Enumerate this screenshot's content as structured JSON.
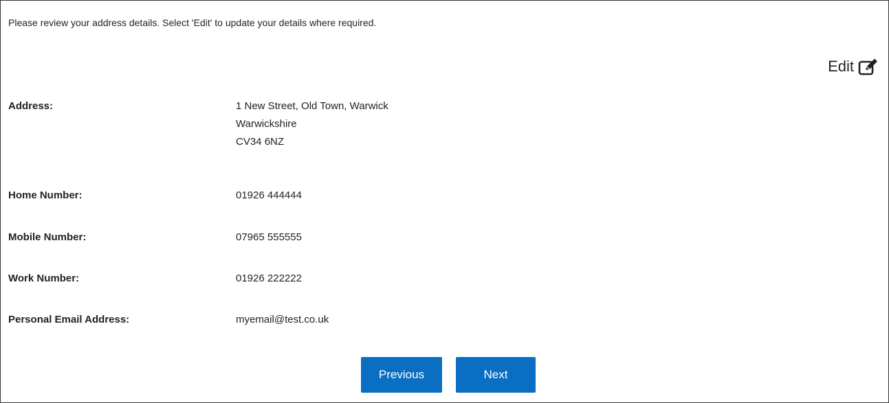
{
  "intro": "Please review your address details. Select 'Edit' to update your details where required.",
  "edit": {
    "label": "Edit",
    "icon": "edit-icon"
  },
  "fields": {
    "address": {
      "label": "Address:",
      "lines": [
        "1 New Street, Old Town, Warwick",
        "Warwickshire",
        "CV34 6NZ"
      ]
    },
    "home": {
      "label": "Home Number:",
      "value": "01926 444444"
    },
    "mobile": {
      "label": "Mobile Number:",
      "value": "07965 555555"
    },
    "work": {
      "label": "Work Number:",
      "value": "01926 222222"
    },
    "email": {
      "label": "Personal Email Address:",
      "value": "myemail@test.co.uk"
    }
  },
  "buttons": {
    "previous": "Previous",
    "next": "Next"
  },
  "colors": {
    "button_bg": "#0a6fc2",
    "button_text": "#ffffff",
    "text": "#222222",
    "border": "#333333"
  }
}
